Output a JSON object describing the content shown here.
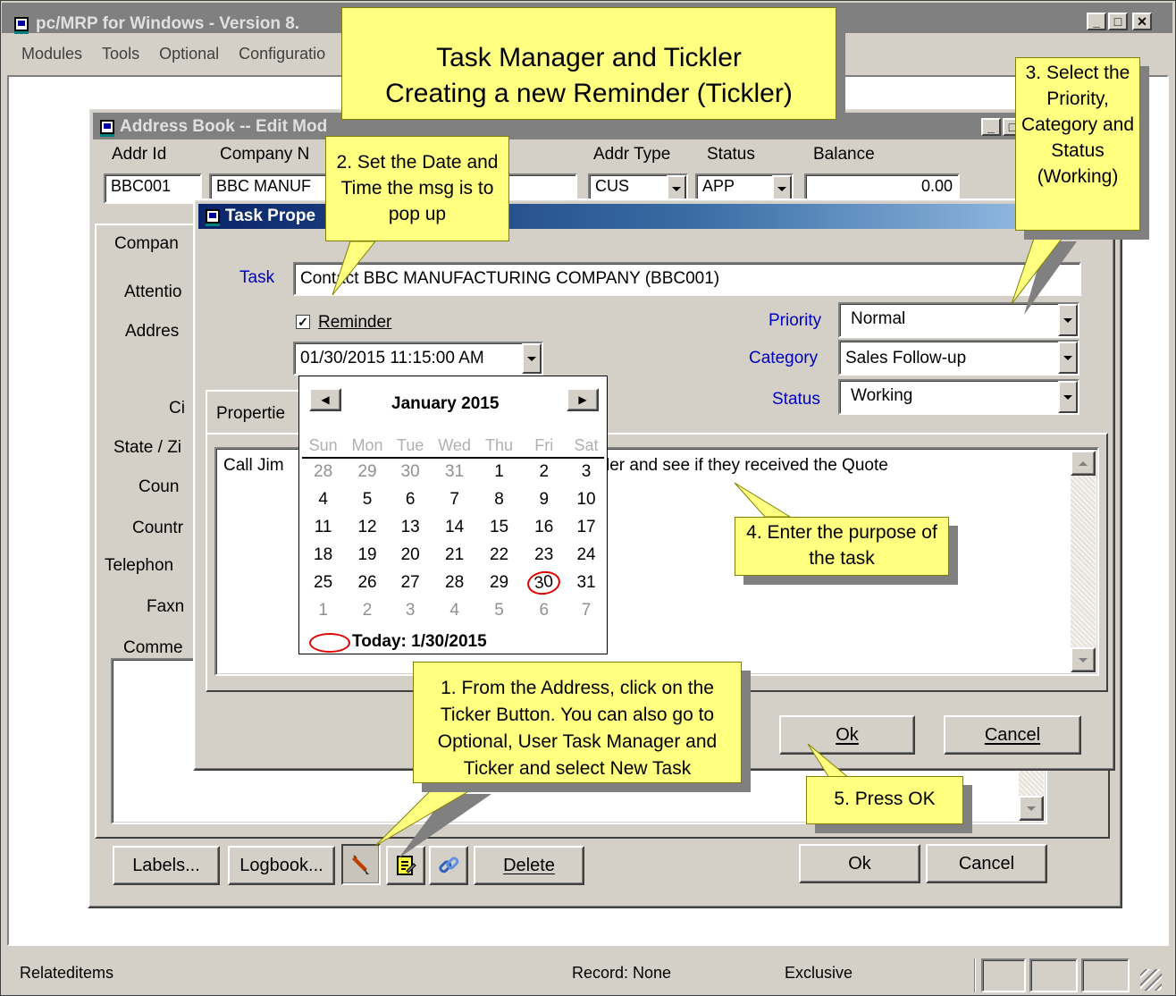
{
  "app": {
    "title": "pc/MRP for Windows - Version 8.",
    "menu": [
      "Modules",
      "Tools",
      "Optional",
      "Configuratio"
    ]
  },
  "address_book": {
    "title": "Address Book -- Edit Mod",
    "headers": {
      "addr_id": "Addr Id",
      "company": "Company N",
      "addr_type": "Addr Type",
      "status": "Status",
      "balance": "Balance"
    },
    "values": {
      "addr_id": "BBC001",
      "company": "BBC MANUF",
      "addr_type": "CUS",
      "status": "APP",
      "balance": "0.00"
    },
    "tab": "Compan",
    "labels": [
      "Attentio",
      "Addres",
      "Ci",
      "State / Zi",
      "Coun",
      "Countr",
      "Telephon",
      "Faxn",
      "Comme"
    ],
    "buttons": {
      "labels": "Labels...",
      "logbook": "Logbook...",
      "delete": "Delete",
      "ok": "Ok",
      "cancel": "Cancel"
    }
  },
  "task": {
    "title": "Task Prope",
    "task_label": "Task",
    "task_value": "Contact BBC MANUFACTURING COMPANY (BBC001)",
    "reminder_label": "Reminder",
    "reminder_checked": true,
    "datetime": "01/30/2015 11:15:00 AM",
    "priority_label": "Priority",
    "priority": "Normal",
    "category_label": "Category",
    "category": "Sales Follow-up",
    "status_label": "Status",
    "status": "Working",
    "tab": "Propertie",
    "notes_left": "Call Jim",
    "notes_right": "ler and see if they received the Quote",
    "ok": "Ok",
    "cancel": "Cancel"
  },
  "calendar": {
    "month": "January 2015",
    "weekdays": [
      "Sun",
      "Mon",
      "Tue",
      "Wed",
      "Thu",
      "Fri",
      "Sat"
    ],
    "weeks": [
      [
        "28",
        "29",
        "30",
        "31",
        "1",
        "2",
        "3"
      ],
      [
        "4",
        "5",
        "6",
        "7",
        "8",
        "9",
        "10"
      ],
      [
        "11",
        "12",
        "13",
        "14",
        "15",
        "16",
        "17"
      ],
      [
        "18",
        "19",
        "20",
        "21",
        "22",
        "23",
        "24"
      ],
      [
        "25",
        "26",
        "27",
        "28",
        "29",
        "30",
        "31"
      ],
      [
        "1",
        "2",
        "3",
        "4",
        "5",
        "6",
        "7"
      ]
    ],
    "today": "Today: 1/30/2015",
    "selected": "30"
  },
  "callouts": {
    "header1": "Task Manager and Tickler",
    "header2": "Creating a new Reminder (Tickler)",
    "c1": "1. From the Address, click on the Ticker Button.  You can also go to Optional, User Task Manager and Ticker and select New Task",
    "c2": "2. Set the Date and Time the msg is to pop up",
    "c3": "3. Select the Priority, Category and Status (Working)",
    "c4": "4. Enter the purpose of the task",
    "c5": "5.  Press OK"
  },
  "statusbar": {
    "left": "Relateditems",
    "record": "Record: None",
    "mode": "Exclusive"
  },
  "colors": {
    "title_active": "#0a246a",
    "title_gradient": "#a6caf0",
    "callout": "#ffff80",
    "face": "#d4d0c8",
    "circle": "#e00000"
  }
}
